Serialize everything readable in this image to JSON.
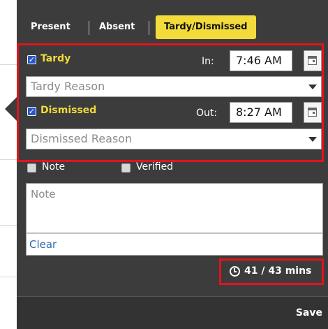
{
  "tabs": [
    {
      "label": "Present",
      "active": false
    },
    {
      "label": "Absent",
      "active": false
    },
    {
      "label": "Tardy/Dismissed",
      "active": true
    }
  ],
  "tardy": {
    "checkbox_label": "Tardy",
    "checked": true,
    "time_label": "In:",
    "time_value": "7:46 AM",
    "reason_placeholder": "Tardy Reason"
  },
  "dismissed": {
    "checkbox_label": "Dismissed",
    "checked": true,
    "time_label": "Out:",
    "time_value": "8:27 AM",
    "reason_placeholder": "Dismissed Reason"
  },
  "options": {
    "note_label": "Note",
    "note_checked": false,
    "verified_label": "Verified",
    "verified_checked": false
  },
  "note": {
    "placeholder": "Note",
    "clear_label": "Clear"
  },
  "time_summary": "41 / 43 mins",
  "footer": {
    "save_label": "Save"
  },
  "colors": {
    "accent_yellow": "#f2db3a",
    "panel_bg": "#3c3c3c",
    "highlight_red": "#e0141d",
    "checkbox_blue": "#2a56c6",
    "link_blue": "#2a6aa8"
  },
  "icons": [
    "checkbox-checked-icon",
    "calendar-icon",
    "chevron-down-icon",
    "clock-icon"
  ]
}
